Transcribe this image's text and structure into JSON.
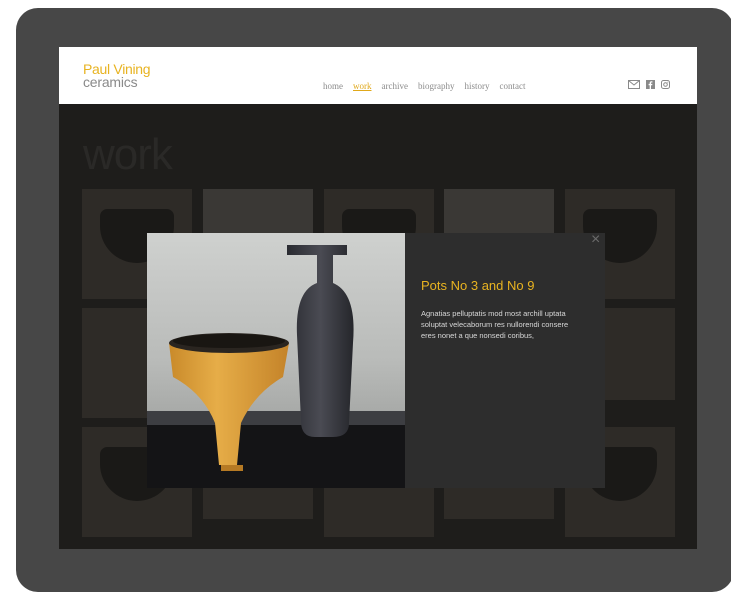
{
  "logo": {
    "line1": "Paul Vining",
    "line2": "ceramics"
  },
  "nav": [
    "home",
    "work",
    "archive",
    "biography",
    "history",
    "contact"
  ],
  "nav_active_index": 1,
  "social": [
    "mail-icon",
    "facebook-icon",
    "instagram-icon"
  ],
  "page": {
    "title": "work"
  },
  "modal": {
    "title": "Pots No 3 and No 9",
    "text": "Agnatias pelluptatis mod most archill uptata soluptat velecaborum res nullorendi consere eres nonet a que nonsedi coribus,",
    "close": "×"
  },
  "colors": {
    "accent": "#e8b321",
    "device": "#474747",
    "overlay": "#1e1d1b",
    "modal_panel": "#2d2d2d"
  }
}
